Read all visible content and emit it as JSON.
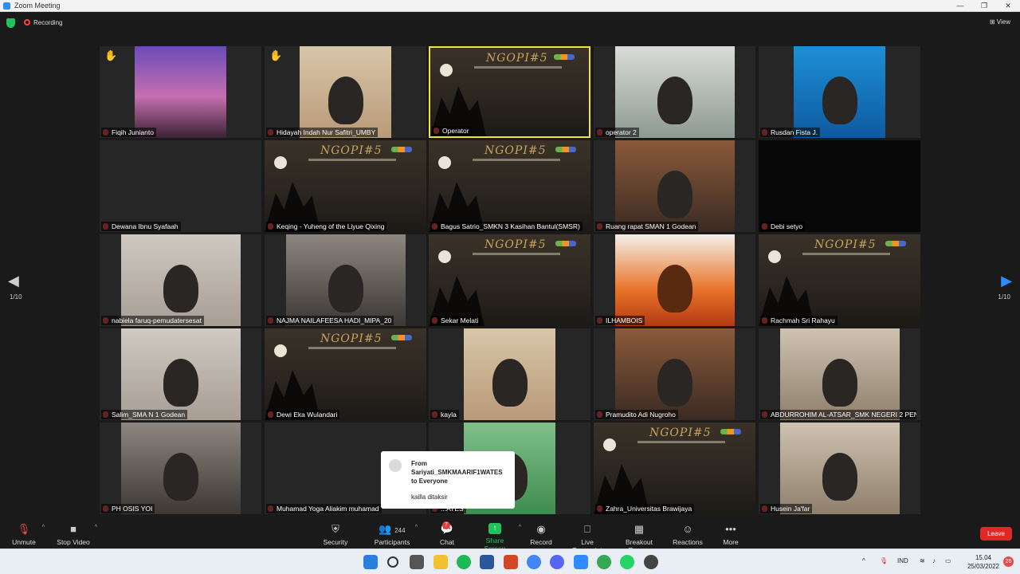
{
  "window": {
    "title": "Zoom Meeting",
    "controls": [
      "—",
      "❐",
      "✕"
    ]
  },
  "meeting": {
    "recording_label": "Recording",
    "view_label": "View",
    "page_indicator": "1/10"
  },
  "participants": [
    {
      "name": "Fiqih Junianto",
      "hand": true,
      "bg": "temple"
    },
    {
      "name": "Hidayah Indah Nur Safitri_UMBY",
      "hand": true,
      "bg": "girl"
    },
    {
      "name": "Operator",
      "active": true,
      "bg": "poster"
    },
    {
      "name": "operator 2",
      "bg": "room"
    },
    {
      "name": "Rusdan Fista J.",
      "bg": "book"
    },
    {
      "name": "Dewana Ibnu Syafaah",
      "bg": "dark"
    },
    {
      "name": "Keqing - Yuheng of the Liyue Qixing",
      "bg": "poster"
    },
    {
      "name": "Bagus Satrio_SMKN 3 Kasihan Bantul(SMSR)",
      "bg": "poster"
    },
    {
      "name": "Ruang rapat SMAN 1 Godean",
      "bg": "meetroom"
    },
    {
      "name": "Debi setyo",
      "bg": "black"
    },
    {
      "name": "nabiela faruq-pemudatersesat",
      "bg": "boy"
    },
    {
      "name": "NAJMA NAILAFEESA HADI_MIPA_20",
      "bg": "group"
    },
    {
      "name": "Sekar Melati",
      "bg": "poster"
    },
    {
      "name": "ILHAMBOIS",
      "bg": "fire"
    },
    {
      "name": "Rachmah Sri Rahayu",
      "bg": "poster"
    },
    {
      "name": "Salim_SMA N 1 Godean",
      "bg": "boy"
    },
    {
      "name": "Dewi Eka Wulandari",
      "bg": "poster"
    },
    {
      "name": "kayla",
      "bg": "girl"
    },
    {
      "name": "Pramudito Adi Nugroho",
      "bg": "meetroom"
    },
    {
      "name": "ABDURROHIM AL-ATSAR_SMK NEGERI 2 PEN...",
      "bg": "man"
    },
    {
      "name": "PH OSIS YOI",
      "bg": "group"
    },
    {
      "name": "Muhamad Yoga Aliakim muhamad",
      "bg": "dark"
    },
    {
      "name": "...ATES",
      "bg": "green"
    },
    {
      "name": "Zahra_Universitas Brawijaya",
      "bg": "poster"
    },
    {
      "name": "Husein Ja'far",
      "bg": "man"
    }
  ],
  "poster": {
    "title": "NGOPI#5"
  },
  "chat_popup": {
    "from": "From Sariyati_SMKMAARIF1WATES to Everyone",
    "message": "kailla ditaksir"
  },
  "toolbar": {
    "unmute": "Unmute",
    "stop_video": "Stop Video",
    "security": "Security",
    "participants": "Participants",
    "participant_count": "244",
    "chat": "Chat",
    "chat_badge": "7",
    "share_screen": "Share Screen",
    "record": "Record",
    "live_transcript": "Live Transcript",
    "breakout_rooms": "Breakout Rooms",
    "reactions": "Reactions",
    "more": "More",
    "leave": "Leave"
  },
  "taskbar": {
    "language": "IND",
    "time": "15.04",
    "date": "25/03/2022",
    "notifications": "26"
  }
}
